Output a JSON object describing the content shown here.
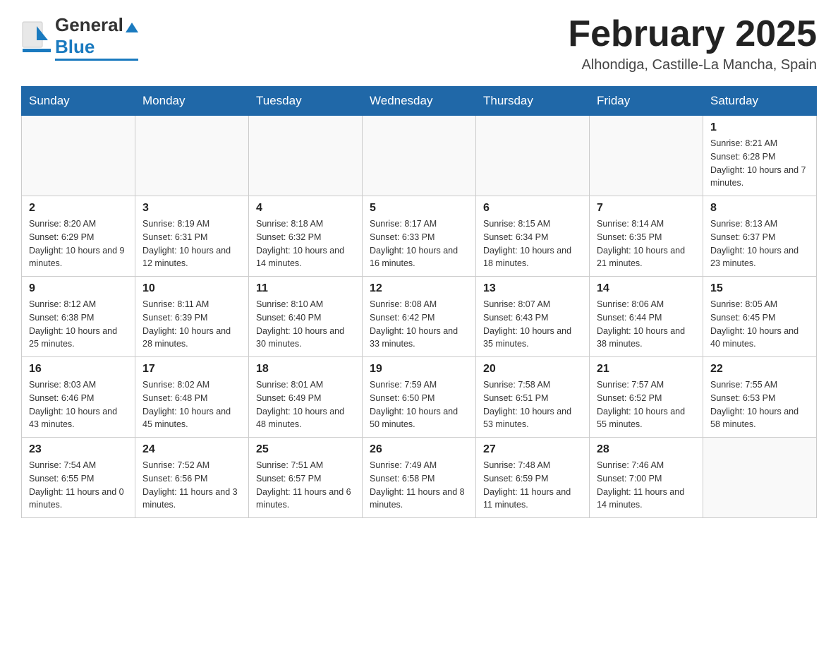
{
  "header": {
    "logo": {
      "general": "General",
      "blue": "Blue",
      "triangle_color": "#1a7abf"
    },
    "title": "February 2025",
    "location": "Alhondiga, Castille-La Mancha, Spain"
  },
  "calendar": {
    "days_of_week": [
      "Sunday",
      "Monday",
      "Tuesday",
      "Wednesday",
      "Thursday",
      "Friday",
      "Saturday"
    ],
    "weeks": [
      [
        {
          "day": "",
          "info": ""
        },
        {
          "day": "",
          "info": ""
        },
        {
          "day": "",
          "info": ""
        },
        {
          "day": "",
          "info": ""
        },
        {
          "day": "",
          "info": ""
        },
        {
          "day": "",
          "info": ""
        },
        {
          "day": "1",
          "info": "Sunrise: 8:21 AM\nSunset: 6:28 PM\nDaylight: 10 hours and 7 minutes."
        }
      ],
      [
        {
          "day": "2",
          "info": "Sunrise: 8:20 AM\nSunset: 6:29 PM\nDaylight: 10 hours and 9 minutes."
        },
        {
          "day": "3",
          "info": "Sunrise: 8:19 AM\nSunset: 6:31 PM\nDaylight: 10 hours and 12 minutes."
        },
        {
          "day": "4",
          "info": "Sunrise: 8:18 AM\nSunset: 6:32 PM\nDaylight: 10 hours and 14 minutes."
        },
        {
          "day": "5",
          "info": "Sunrise: 8:17 AM\nSunset: 6:33 PM\nDaylight: 10 hours and 16 minutes."
        },
        {
          "day": "6",
          "info": "Sunrise: 8:15 AM\nSunset: 6:34 PM\nDaylight: 10 hours and 18 minutes."
        },
        {
          "day": "7",
          "info": "Sunrise: 8:14 AM\nSunset: 6:35 PM\nDaylight: 10 hours and 21 minutes."
        },
        {
          "day": "8",
          "info": "Sunrise: 8:13 AM\nSunset: 6:37 PM\nDaylight: 10 hours and 23 minutes."
        }
      ],
      [
        {
          "day": "9",
          "info": "Sunrise: 8:12 AM\nSunset: 6:38 PM\nDaylight: 10 hours and 25 minutes."
        },
        {
          "day": "10",
          "info": "Sunrise: 8:11 AM\nSunset: 6:39 PM\nDaylight: 10 hours and 28 minutes."
        },
        {
          "day": "11",
          "info": "Sunrise: 8:10 AM\nSunset: 6:40 PM\nDaylight: 10 hours and 30 minutes."
        },
        {
          "day": "12",
          "info": "Sunrise: 8:08 AM\nSunset: 6:42 PM\nDaylight: 10 hours and 33 minutes."
        },
        {
          "day": "13",
          "info": "Sunrise: 8:07 AM\nSunset: 6:43 PM\nDaylight: 10 hours and 35 minutes."
        },
        {
          "day": "14",
          "info": "Sunrise: 8:06 AM\nSunset: 6:44 PM\nDaylight: 10 hours and 38 minutes."
        },
        {
          "day": "15",
          "info": "Sunrise: 8:05 AM\nSunset: 6:45 PM\nDaylight: 10 hours and 40 minutes."
        }
      ],
      [
        {
          "day": "16",
          "info": "Sunrise: 8:03 AM\nSunset: 6:46 PM\nDaylight: 10 hours and 43 minutes."
        },
        {
          "day": "17",
          "info": "Sunrise: 8:02 AM\nSunset: 6:48 PM\nDaylight: 10 hours and 45 minutes."
        },
        {
          "day": "18",
          "info": "Sunrise: 8:01 AM\nSunset: 6:49 PM\nDaylight: 10 hours and 48 minutes."
        },
        {
          "day": "19",
          "info": "Sunrise: 7:59 AM\nSunset: 6:50 PM\nDaylight: 10 hours and 50 minutes."
        },
        {
          "day": "20",
          "info": "Sunrise: 7:58 AM\nSunset: 6:51 PM\nDaylight: 10 hours and 53 minutes."
        },
        {
          "day": "21",
          "info": "Sunrise: 7:57 AM\nSunset: 6:52 PM\nDaylight: 10 hours and 55 minutes."
        },
        {
          "day": "22",
          "info": "Sunrise: 7:55 AM\nSunset: 6:53 PM\nDaylight: 10 hours and 58 minutes."
        }
      ],
      [
        {
          "day": "23",
          "info": "Sunrise: 7:54 AM\nSunset: 6:55 PM\nDaylight: 11 hours and 0 minutes."
        },
        {
          "day": "24",
          "info": "Sunrise: 7:52 AM\nSunset: 6:56 PM\nDaylight: 11 hours and 3 minutes."
        },
        {
          "day": "25",
          "info": "Sunrise: 7:51 AM\nSunset: 6:57 PM\nDaylight: 11 hours and 6 minutes."
        },
        {
          "day": "26",
          "info": "Sunrise: 7:49 AM\nSunset: 6:58 PM\nDaylight: 11 hours and 8 minutes."
        },
        {
          "day": "27",
          "info": "Sunrise: 7:48 AM\nSunset: 6:59 PM\nDaylight: 11 hours and 11 minutes."
        },
        {
          "day": "28",
          "info": "Sunrise: 7:46 AM\nSunset: 7:00 PM\nDaylight: 11 hours and 14 minutes."
        },
        {
          "day": "",
          "info": ""
        }
      ]
    ]
  }
}
